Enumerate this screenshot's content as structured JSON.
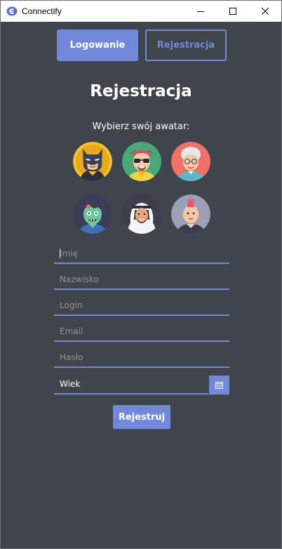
{
  "window": {
    "title": "Connectify",
    "icon": "connectify-logo-icon"
  },
  "tabs": {
    "login_label": "Logowanie",
    "register_label": "Rejestracja"
  },
  "form": {
    "title": "Rejestracja",
    "avatar_prompt": "Wybierz swój awatar:",
    "avatars": [
      "batman-avatar",
      "heisenberg-avatar",
      "grandma-avatar",
      "zombie-avatar",
      "sheikh-avatar",
      "punk-avatar"
    ],
    "fields": {
      "first_name_placeholder": "Imię",
      "last_name_placeholder": "Nazwisko",
      "login_placeholder": "Login",
      "email_placeholder": "Email",
      "password_placeholder": "Hasło",
      "age_placeholder": "Wiek"
    },
    "submit_label": "Rejestruj"
  },
  "colors": {
    "accent": "#7289da",
    "background": "#40444b",
    "text": "#ffffff",
    "placeholder": "#8e9297"
  }
}
